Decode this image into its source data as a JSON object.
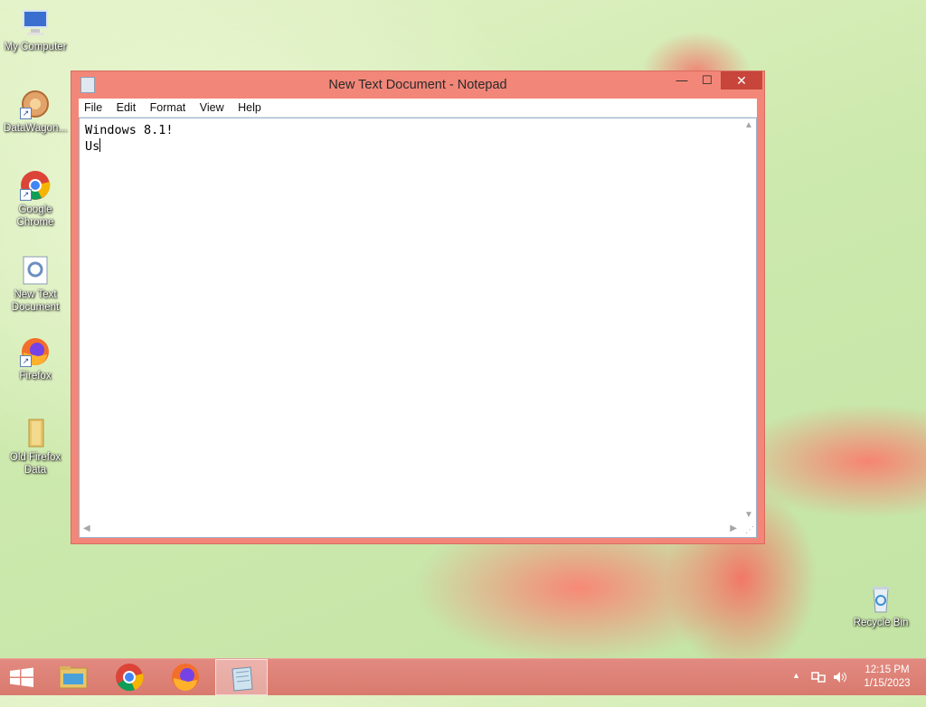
{
  "desktop": {
    "icons": [
      {
        "label": "My Computer"
      },
      {
        "label": "DataWagon..."
      },
      {
        "label": "Google Chrome"
      },
      {
        "label": "New Text Document"
      },
      {
        "label": "Firefox"
      },
      {
        "label": "Old Firefox Data"
      },
      {
        "label": "Recycle Bin"
      }
    ]
  },
  "window": {
    "title": "New Text Document - Notepad",
    "controls": {
      "minimize": "—",
      "maximize": "☐",
      "close": "✕"
    },
    "menu": [
      "File",
      "Edit",
      "Format",
      "View",
      "Help"
    ],
    "content": {
      "line1": "Windows 8.1!",
      "line2": "Us"
    }
  },
  "taskbar": {
    "start_icon": "windows-logo-icon",
    "apps": [
      "file-explorer-icon",
      "chrome-icon",
      "firefox-icon",
      "notepad-icon"
    ],
    "tray": {
      "expand": "▲"
    },
    "clock": {
      "time": "12:15 PM",
      "date": "1/15/2023"
    }
  }
}
